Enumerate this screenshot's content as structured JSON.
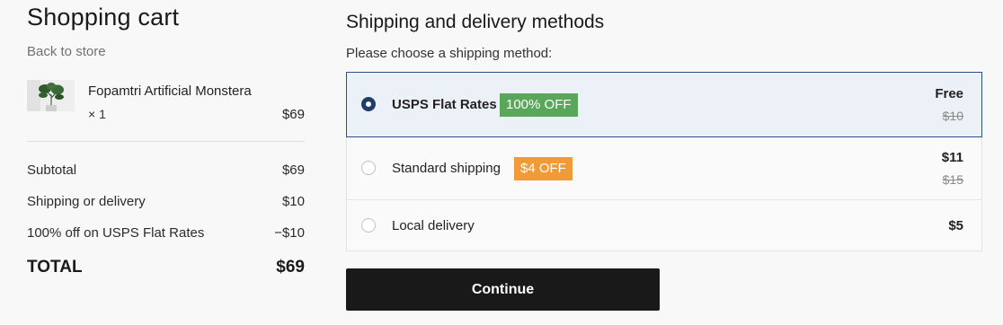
{
  "cart": {
    "title": "Shopping cart",
    "back_link": "Back to store",
    "item": {
      "name": "Fopamtri Artificial Monstera",
      "quantity": "× 1",
      "price": "$69"
    },
    "summary": [
      {
        "label": "Subtotal",
        "value": "$69"
      },
      {
        "label": "Shipping or delivery",
        "value": "$10"
      },
      {
        "label": "100% off on USPS Flat Rates",
        "value": "−$10"
      }
    ],
    "total": {
      "label": "TOTAL",
      "value": "$69"
    }
  },
  "shipping": {
    "title": "Shipping and delivery methods",
    "prompt": "Please choose a shipping method:",
    "options": [
      {
        "label": "USPS Flat Rates",
        "badge": "100% OFF",
        "badge_color": "#5aa75b",
        "price": "Free",
        "old_price": "$10",
        "selected": true
      },
      {
        "label": "Standard shipping",
        "badge": "$4 OFF",
        "badge_color": "#f09a38",
        "price": "$11",
        "old_price": "$15",
        "selected": false
      },
      {
        "label": "Local delivery",
        "price": "$5",
        "selected": false
      }
    ],
    "continue_label": "Continue"
  },
  "colors": {
    "accent": "#213e6a",
    "selected_bg": "#ecf1f7",
    "button_bg": "#191919"
  }
}
